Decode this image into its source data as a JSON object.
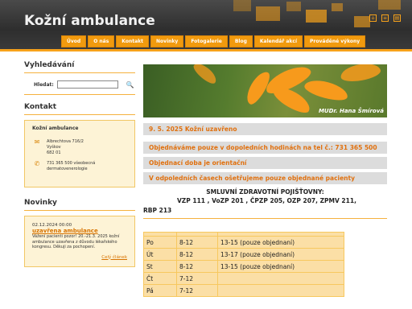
{
  "header": {
    "site_title": "Kožní ambulance",
    "nav": [
      "Úvod",
      "O nás",
      "Kontakt",
      "Novinky",
      "Fotogalerie",
      "Blog",
      "Kalendář akcí",
      "Prováděné výkony"
    ],
    "accent_color": "#f7a21b",
    "icons": [
      "home-icon",
      "sitemap-icon",
      "print-icon"
    ]
  },
  "sidebar": {
    "search": {
      "heading": "Vyhledávání",
      "label": "Hledat:",
      "placeholder": ""
    },
    "contact": {
      "heading": "Kontakt",
      "name": "Kožní ambulance",
      "address": [
        "Albrechtova 716/2",
        "Vyškov",
        "682 01"
      ],
      "phone": "731 365 500 všeobecná dermatovenerologie"
    },
    "news": {
      "heading": "Novinky",
      "date": "02.12.2024 00:00",
      "title": "uzavřena ambulance",
      "text": "Vážení pacienti pozor! 20.-21.3. 2025 kožní ambulance uzavřena z důvodu lékařského kongresu. Děkuji za pochopení.",
      "more": "Celý článek"
    }
  },
  "main": {
    "banner_caption": "MUDr. Hana Šmírová",
    "bars": [
      "9. 5. 2025  Kožní uzavřeno",
      "Objednáváme pouze v dopoledních hodinách na tel č.: 731 365 500",
      "Objednací doba je orientační",
      "V odpoledních časech ošetřujeme pouze objednané pacienty"
    ],
    "insurance_heading": "SMLUVNÍ ZDRAVOTNÍ POJIŠŤOVNY:",
    "insurance_line1": "VZP  111 , VoZP 201 , ČPZP 205,  OZP  207, ZPMV 211,",
    "insurance_line2": "RBP 213",
    "hours": [
      {
        "day": "Po",
        "morning": "8-12",
        "afternoon": "13-15  (pouze objednaní)"
      },
      {
        "day": "Út",
        "morning": "8-12",
        "afternoon": "13-17  (pouze objednaní)"
      },
      {
        "day": "St",
        "morning": "8-12",
        "afternoon": "13-15  (pouze objednaní)"
      },
      {
        "day": "Čt",
        "morning": "7-12",
        "afternoon": ""
      },
      {
        "day": "Pá",
        "morning": "7-12",
        "afternoon": ""
      }
    ]
  }
}
